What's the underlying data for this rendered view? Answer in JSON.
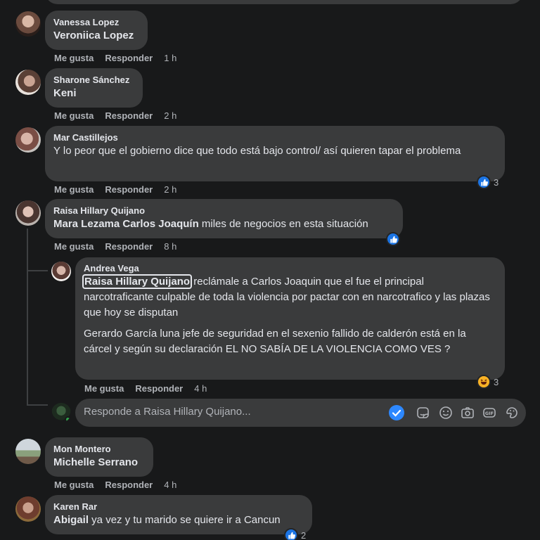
{
  "comments": [
    {
      "author": "Vanessa Lopez",
      "mention": "Veroniica Lopez",
      "like_label": "Me gusta",
      "reply_label": "Responder",
      "time": "1 h"
    },
    {
      "author": "Sharone Sánchez",
      "mention": "Keni",
      "like_label": "Me gusta",
      "reply_label": "Responder",
      "time": "2 h"
    },
    {
      "author": "Mar Castillejos",
      "text": "Y lo peor que el gobierno dice que todo está bajo control/ así quieren tapar el problema",
      "like_label": "Me gusta",
      "reply_label": "Responder",
      "time": "2 h",
      "reaction_count": "3"
    },
    {
      "author": "Raisa Hillary Quijano",
      "mention": "Mara Lezama Carlos Joaquín",
      "text": " miles de negocios en esta situación",
      "like_label": "Me gusta",
      "reply_label": "Responder",
      "time": "8 h"
    },
    {
      "author": "Mon Montero",
      "mention": "Michelle Serrano",
      "like_label": "Me gusta",
      "reply_label": "Responder",
      "time": "4 h"
    },
    {
      "author": "Karen Rar",
      "mention": "Abigail",
      "text": " ya vez y tu marido se quiere ir a Cancun",
      "reaction_count": "2"
    }
  ],
  "reply": {
    "author": "Andrea Vega",
    "mention": "Raisa Hillary Quijano",
    "text_1": " reclámale a Carlos Joaquin que el fue el principal narcotraficante culpable de toda la violencia por pactar con en narcotrafico y las plazas que hoy se disputan",
    "text_2": "Gerardo García luna jefe de seguridad en el sexenio fallido de calderón está en la cárcel y según su declaración EL NO SABÍA DE LA VIOLENCIA COMO VES ?",
    "like_label": "Me gusta",
    "reply_label": "Responder",
    "time": "4 h",
    "reaction_count": "3"
  },
  "reply_box": {
    "placeholder": "Responde a Raisa Hillary Quijano...",
    "icons": [
      "check-icon",
      "sticker-icon",
      "emoji-icon",
      "camera-icon",
      "gif-icon",
      "avatar-sticker-icon"
    ]
  },
  "colors": {
    "background": "#18191a",
    "bubble": "#3a3b3c",
    "text": "#e4e6eb",
    "muted": "#b0b3b8",
    "like_blue": "#1b74e4",
    "check_blue": "#2d88ff"
  }
}
